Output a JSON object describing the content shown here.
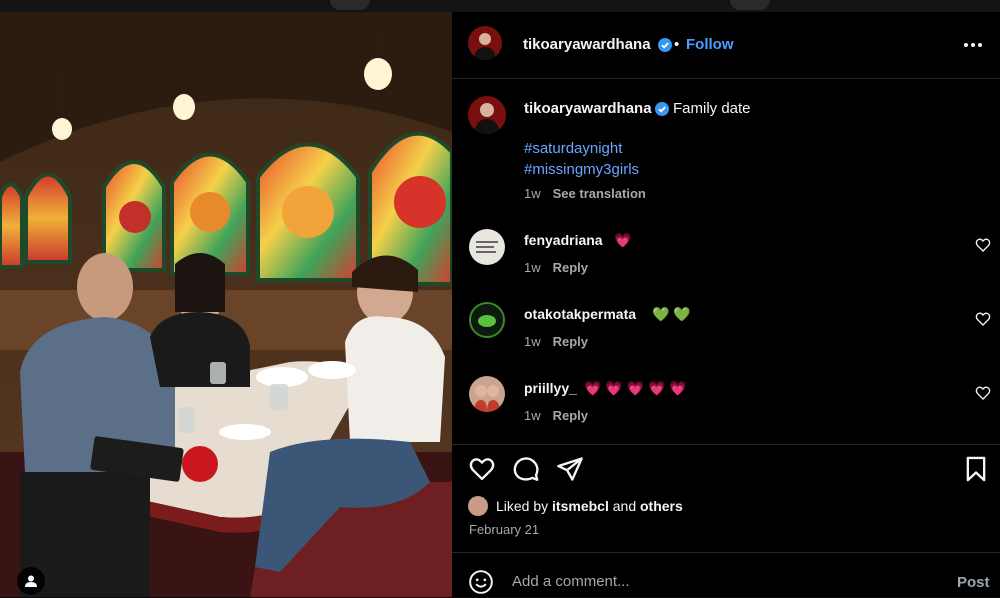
{
  "post": {
    "owner": "tikoaryawardhana",
    "follow_label": "Follow",
    "separator": "•",
    "caption": "Family date",
    "hashtags": [
      "#saturdaynight",
      "#missingmy3girls"
    ],
    "age": "1w",
    "see_translation": "See translation"
  },
  "comments": [
    {
      "user": "fenyadriana",
      "text": "💗",
      "age": "1w",
      "reply": "Reply"
    },
    {
      "user": "otakotakpermata",
      "text": "💚 💚",
      "age": "1w",
      "reply": "Reply"
    },
    {
      "user": "priillyy_",
      "text": "💗 💗 💗 💗 💗",
      "age": "1w",
      "reply": "Reply"
    }
  ],
  "likes": {
    "prefix": "Liked by",
    "user": "itsmebcl",
    "joiner": "and",
    "others": "others"
  },
  "date": "February 21",
  "composer": {
    "placeholder": "Add a comment...",
    "post_label": "Post"
  },
  "colors": {
    "accent": "#4a9eff",
    "hashtag": "#6aa6ff",
    "muted": "#a8a8a8",
    "background": "#000000"
  },
  "icons": [
    "verified-badge-icon",
    "more-options-icon",
    "heart-icon",
    "comment-icon",
    "share-icon",
    "bookmark-icon",
    "emoji-icon",
    "user-tag-icon"
  ]
}
